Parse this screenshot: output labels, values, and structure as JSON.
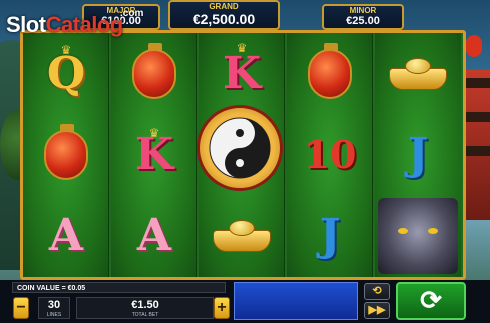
{
  "jackpots": {
    "major": {
      "label": "MAJOR",
      "value": "€100.00"
    },
    "grand": {
      "label": "GRAND",
      "value": "€2,500.00"
    },
    "minor": {
      "label": "MINOR",
      "value": "€25.00"
    }
  },
  "watermark": {
    "brand_part1": "Slot",
    "brand_part2": "Catalog",
    "suffix": ".com"
  },
  "reels": [
    [
      "Q",
      "lantern",
      "A"
    ],
    [
      "lantern",
      "K",
      "A"
    ],
    [
      "K",
      "yin-yang",
      "gold-ingot"
    ],
    [
      "lantern",
      "10",
      "J"
    ],
    [
      "gold-ingot",
      "J",
      "tiger"
    ]
  ],
  "controls": {
    "coin_value": "COIN VALUE = €0.05",
    "lines_value": "30",
    "lines_label": "LINES",
    "total_bet_value": "€1.50",
    "total_bet_label": "TOTAL BET",
    "minus_label": "−",
    "plus_label": "+",
    "autoplay_icon": "⟲",
    "fast_icon": "▶▶",
    "spin_icon": "⟳"
  },
  "colors": {
    "reel_green": "#1e6b1e",
    "frame_gold": "#d49a2a",
    "spin_green": "#1fa02a",
    "message_blue": "#1f4fd0"
  }
}
